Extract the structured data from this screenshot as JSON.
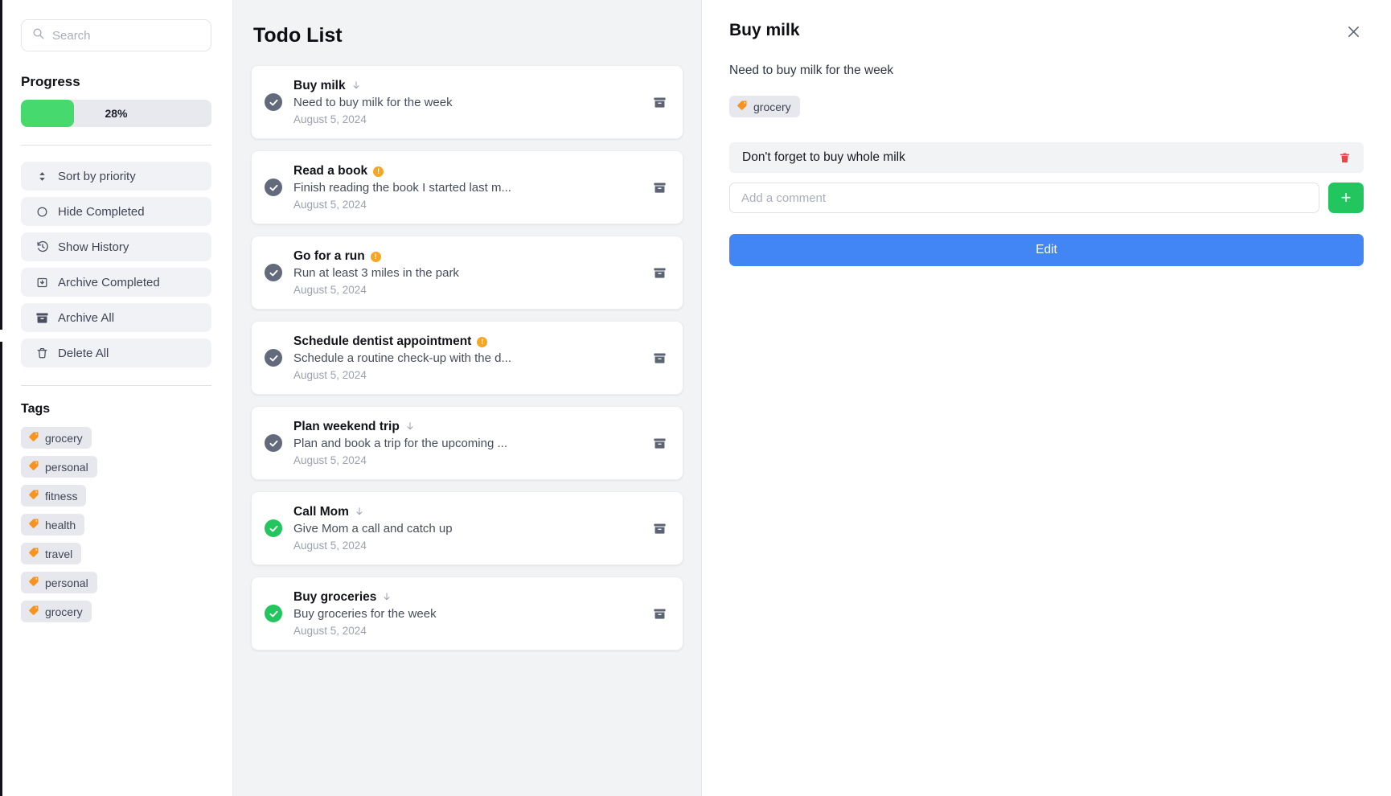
{
  "sidebar": {
    "search": {
      "placeholder": "Search",
      "value": "",
      "icon": "search-icon"
    },
    "progress": {
      "label": "Progress",
      "percent_text": "28%",
      "percent": 28,
      "fill_color": "#45d96e",
      "track_color": "#e7e9ee"
    },
    "menu": [
      {
        "label": "Sort by priority",
        "icon": "sort-updown-icon"
      },
      {
        "label": "Hide Completed",
        "icon": "circle-icon"
      },
      {
        "label": "Show History",
        "icon": "clock-history-icon"
      },
      {
        "label": "Archive Completed",
        "icon": "archive-down-icon"
      },
      {
        "label": "Archive All",
        "icon": "archive-box-icon"
      },
      {
        "label": "Delete All",
        "icon": "trash-icon"
      }
    ],
    "tags_title": "Tags",
    "tags": [
      {
        "label": "grocery",
        "icon": "tag-icon"
      },
      {
        "label": "personal",
        "icon": "tag-icon"
      },
      {
        "label": "fitness",
        "icon": "tag-icon"
      },
      {
        "label": "health",
        "icon": "tag-icon"
      },
      {
        "label": "travel",
        "icon": "tag-icon"
      },
      {
        "label": "personal",
        "icon": "tag-icon"
      },
      {
        "label": "grocery",
        "icon": "tag-icon"
      }
    ],
    "tag_icon_color": "#f7931e"
  },
  "list": {
    "title": "Todo List",
    "items": [
      {
        "title": "Buy milk",
        "desc": "Need to buy milk for the week",
        "date": "August 5, 2024",
        "priority": "low",
        "completed": false,
        "archive_icon": "archive-box-icon"
      },
      {
        "title": "Read a book",
        "desc": "Finish reading the book I started last m...",
        "date": "August 5, 2024",
        "priority": "high",
        "completed": false,
        "archive_icon": "archive-box-icon"
      },
      {
        "title": "Go for a run",
        "desc": "Run at least 3 miles in the park",
        "date": "August 5, 2024",
        "priority": "high",
        "completed": false,
        "archive_icon": "archive-box-icon"
      },
      {
        "title": "Schedule dentist appointment",
        "desc": "Schedule a routine check-up with the d...",
        "date": "August 5, 2024",
        "priority": "high",
        "completed": false,
        "archive_icon": "archive-box-icon"
      },
      {
        "title": "Plan weekend trip",
        "desc": "Plan and book a trip for the upcoming ...",
        "date": "August 5, 2024",
        "priority": "low",
        "completed": false,
        "archive_icon": "archive-box-icon"
      },
      {
        "title": "Call Mom",
        "desc": "Give Mom a call and catch up",
        "date": "August 5, 2024",
        "priority": "low",
        "completed": true,
        "archive_icon": "archive-box-icon"
      },
      {
        "title": "Buy groceries",
        "desc": "Buy groceries for the week",
        "date": "August 5, 2024",
        "priority": "low",
        "completed": true,
        "archive_icon": "archive-box-icon"
      }
    ]
  },
  "detail": {
    "title": "Buy milk",
    "close_icon": "close-icon",
    "description": "Need to buy milk for the week",
    "tags": [
      {
        "label": "grocery",
        "icon": "tag-icon"
      }
    ],
    "comments": [
      {
        "text": "Don't forget to buy whole milk",
        "delete_icon": "trash-icon",
        "delete_color": "#ef4444"
      }
    ],
    "comment_input": {
      "placeholder": "Add a comment",
      "value": ""
    },
    "add_button": {
      "label": "+",
      "color": "#22c55e"
    },
    "edit_button": {
      "label": "Edit",
      "color": "#4285f4"
    }
  }
}
